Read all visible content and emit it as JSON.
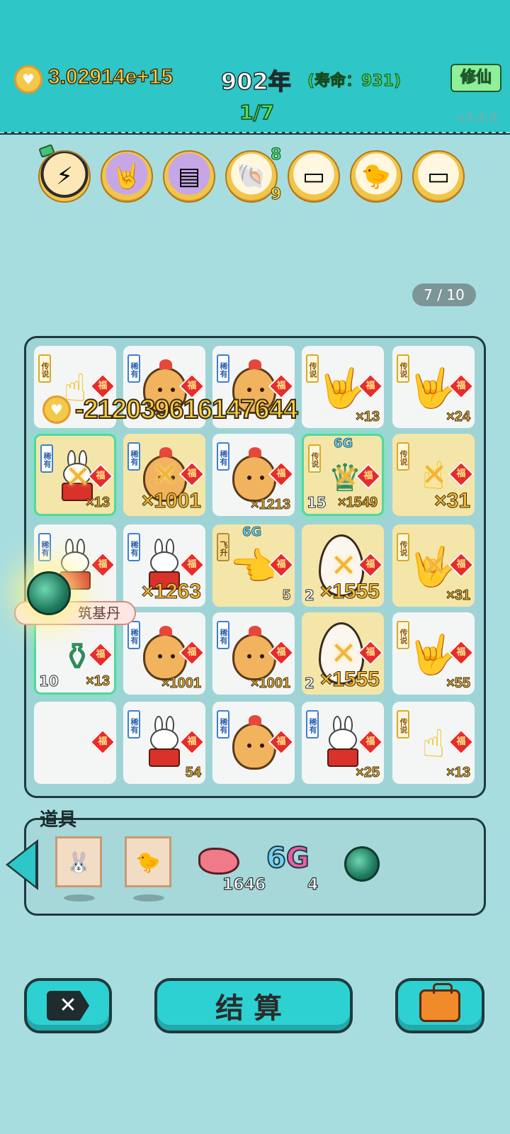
{
  "header": {
    "gold": "3.02914e+15",
    "year": "902年",
    "lifespan": "(寿命：931)",
    "xiuxian_label": "修仙",
    "progress": "1/7",
    "version": "v3.4.9"
  },
  "buffs": [
    {
      "icon": "lightning-icon",
      "glyph": "⚡"
    },
    {
      "icon": "rock-hand-icon",
      "glyph": "🤘"
    },
    {
      "icon": "skirt-icon",
      "glyph": "▤"
    },
    {
      "icon": "shell-icon",
      "glyph": "🐚",
      "count_top": "8",
      "count_bottom": "9"
    },
    {
      "icon": "tissue-box-icon",
      "glyph": "▭"
    },
    {
      "icon": "chick-egg-icon",
      "glyph": "🐤"
    },
    {
      "icon": "tissue-box-icon",
      "glyph": "▭"
    }
  ],
  "page_indicator": "7 / 10",
  "damage_text": "-2120396161476​44",
  "damage_value": "-212039616147644",
  "orb_label": "筑基丹",
  "grid": {
    "tag_rare": "稀有",
    "tag_legend": "传说",
    "tag_fly": "飞升",
    "fu": "福",
    "g6": "6G",
    "cells": [
      {
        "count": "×13"
      },
      {
        "count": ""
      },
      {
        "count": ""
      },
      {
        "count": "×13"
      },
      {
        "count": "×24"
      },
      {
        "count": "×13"
      },
      {
        "count": "×1001"
      },
      {
        "count": "×1213"
      },
      {
        "level": "15",
        "count": "×1549"
      },
      {
        "count": "×31"
      },
      {
        "count": ""
      },
      {
        "count": "×1263"
      },
      {
        "level": "",
        "count": "5"
      },
      {
        "level": "2",
        "count": "×1555"
      },
      {
        "count": "×31"
      },
      {
        "level": "10",
        "count": "×13"
      },
      {
        "count": "×1001"
      },
      {
        "count": "×1001"
      },
      {
        "level": "2",
        "count": "×1555"
      },
      {
        "count": "×55"
      },
      {
        "count": ""
      },
      {
        "count": "54"
      },
      {
        "count": ""
      },
      {
        "count": "×25"
      },
      {
        "count": "×13"
      }
    ]
  },
  "items": {
    "title": "道具",
    "liver_count": "1646",
    "g6_count": "4",
    "g6_label_a": "6",
    "g6_label_b": "G"
  },
  "buttons": {
    "close": "✕",
    "settle": "结算"
  }
}
